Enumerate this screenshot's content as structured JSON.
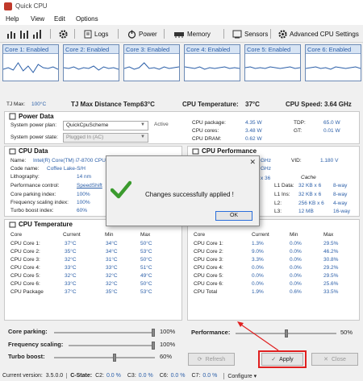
{
  "window": {
    "title": "Quick CPU"
  },
  "menu": [
    "Help",
    "View",
    "Edit",
    "Options"
  ],
  "toolbar": {
    "logs": "Logs",
    "power": "Power",
    "memory": "Memory",
    "sensors": "Sensors",
    "advanced": "Advanced CPU Settings"
  },
  "cores": [
    {
      "label": "Core 1: Enabled",
      "trace": [
        14,
        16,
        13,
        22,
        12,
        18,
        10,
        20,
        16,
        15,
        17,
        14
      ]
    },
    {
      "label": "Core 2: Enabled",
      "trace": [
        16,
        15,
        17,
        14,
        16,
        15,
        18,
        13,
        17,
        15,
        16,
        14
      ]
    },
    {
      "label": "Core 3: Enabled",
      "trace": [
        15,
        17,
        14,
        16,
        22,
        15,
        16,
        14,
        17,
        15,
        16,
        17
      ]
    },
    {
      "label": "Core 4: Enabled",
      "trace": [
        17,
        16,
        15,
        17,
        14,
        16,
        15,
        16,
        17,
        15,
        16,
        15
      ]
    },
    {
      "label": "Core 5: Enabled",
      "trace": [
        16,
        17,
        15,
        16,
        15,
        17,
        16,
        15,
        16,
        17,
        15,
        16
      ]
    },
    {
      "label": "Core 6: Enabled",
      "trace": [
        15,
        16,
        17,
        15,
        16,
        14,
        17,
        16,
        15,
        16,
        17,
        15
      ]
    }
  ],
  "status": {
    "tjmax_label": "TJ Max:",
    "tjmax_value": "100°C",
    "tjdist_label": "TJ Max Distance Temp:",
    "tjdist_value": "63°C",
    "cputemp_label": "CPU Temperature:",
    "cputemp_value": "37°C",
    "cpuspeed_label": "CPU Speed:",
    "cpuspeed_value": "3.64 GHz"
  },
  "power": {
    "title": "Power Data",
    "plan_label": "System power plan:",
    "plan_value": "QuickCpuScheme",
    "plan_status": "Active",
    "state_label": "System power state:",
    "state_value": "Plugged In (AC)",
    "rows": [
      {
        "label": "CPU package:",
        "value": "4.35 W"
      },
      {
        "label": "CPU cores:",
        "value": "3.48 W"
      },
      {
        "label": "CPU DRAM:",
        "value": "0.62 W"
      }
    ],
    "tdp_label": "TDP:",
    "tdp_value": "65.0 W",
    "gt_label": "GT:",
    "gt_value": "0.01 W"
  },
  "cpudata": {
    "title": "CPU Data",
    "name_label": "Name:",
    "name_value": "Intel(R) Core(TM) i7-8700 CPU",
    "codename_label": "Code name:",
    "codename_value": "Coffee Lake-S/H",
    "litho_label": "Lithography:",
    "litho_value": "14 nm",
    "perf_label": "Performance control:",
    "perf_value": "SpeedShift",
    "parking_label": "Core parking index:",
    "parking_value": "100%",
    "freqscale_label": "Frequency scaling index:",
    "freqscale_value": "100%",
    "turbo_label": "Turbo boost index:",
    "turbo_value": "60%"
  },
  "cpuperf": {
    "title": "CPU Performance",
    "ghz1": "GHz",
    "ghz2": "GHz",
    "x36": "x 36",
    "vid_label": "VID:",
    "vid_value": "1.180 V",
    "cache_label": "Cache",
    "cache": [
      {
        "label": "L1 Data:",
        "size": "32 KB x 6",
        "way": "8-way"
      },
      {
        "label": "L1 Ins:",
        "size": "32 KB x 6",
        "way": "8-way"
      },
      {
        "label": "L2:",
        "size": "256 KB x 6",
        "way": "4-way"
      },
      {
        "label": "L3:",
        "size": "12 MB",
        "way": "16-way"
      }
    ]
  },
  "temps": {
    "title": "CPU Temperature",
    "headers": [
      "Core",
      "Current",
      "Min",
      "Max"
    ],
    "rows": [
      [
        "CPU Core 1:",
        "37°C",
        "34°C",
        "50°C"
      ],
      [
        "CPU Core 2:",
        "35°C",
        "34°C",
        "53°C"
      ],
      [
        "CPU Core 3:",
        "32°C",
        "31°C",
        "50°C"
      ],
      [
        "CPU Core 4:",
        "33°C",
        "33°C",
        "51°C"
      ],
      [
        "CPU Core 5:",
        "32°C",
        "32°C",
        "49°C"
      ],
      [
        "CPU Core 6:",
        "33°C",
        "32°C",
        "50°C"
      ],
      [
        "CPU Package",
        "37°C",
        "35°C",
        "53°C"
      ]
    ]
  },
  "util": {
    "headers": [
      "Core",
      "Current",
      "Min",
      "Max"
    ],
    "rows": [
      [
        "CPU Core 1:",
        "1.3%",
        "0.0%",
        "29.5%"
      ],
      [
        "CPU Core 2:",
        "9.0%",
        "0.0%",
        "46.2%"
      ],
      [
        "CPU Core 3:",
        "3.3%",
        "0.0%",
        "30.8%"
      ],
      [
        "CPU Core 4:",
        "0.0%",
        "0.0%",
        "29.2%"
      ],
      [
        "CPU Core 5:",
        "0.0%",
        "0.0%",
        "29.5%"
      ],
      [
        "CPU Core 6:",
        "0.0%",
        "0.0%",
        "25.6%"
      ],
      [
        "CPU Total",
        "1.9%",
        "0.6%",
        "33.5%"
      ]
    ]
  },
  "sliders": {
    "parking_label": "Core parking:",
    "parking_value": "100%",
    "parking_level": 1.0,
    "freq_label": "Frequency scaling:",
    "freq_value": "100%",
    "freq_level": 1.0,
    "turbo_label": "Turbo boost:",
    "turbo_value": "60%",
    "turbo_level": 0.6,
    "perf_label": "Performance:",
    "perf_value": "50%",
    "perf_level": 0.5
  },
  "buttons": {
    "refresh": "Refresh",
    "apply": "Apply",
    "close": "Close"
  },
  "dialog": {
    "message": "Changes successfully applied !",
    "ok": "OK"
  },
  "statusbar": {
    "version_label": "Current version:",
    "version_value": "3.5.0.0",
    "cstate_label": "C-State:",
    "c2_label": "C2:",
    "c2_value": "0.0 %",
    "c3_label": "C3:",
    "c3_value": "0.0 %",
    "c6_label": "C6:",
    "c6_value": "0.0 %",
    "c7_label": "C7:",
    "c7_value": "0.0 %",
    "configure": "Configure"
  },
  "colors": {
    "accent": "#2a5ea8",
    "annotation_red": "#e02020"
  }
}
